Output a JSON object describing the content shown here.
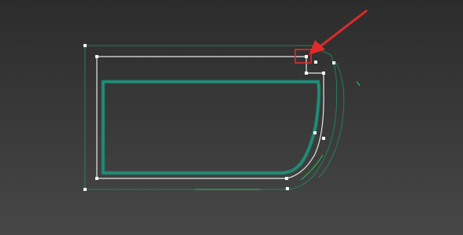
{
  "viewport": {
    "background_top": "#2c2c2c",
    "background_bottom": "#474747"
  },
  "colors": {
    "outline_green": "#1f8a63",
    "inner_shape_teal": "#1f7d6c",
    "inner_shape_teal_light": "#2fa286",
    "selection_white": "#e8e8e8",
    "vertex_fill": "#ffffff",
    "bright_green": "#28c24b",
    "highlight_red": "#e02a2a"
  },
  "annotations": {
    "pointer_arrow": "red-arrow",
    "highlight_box": "red-selection-box"
  }
}
